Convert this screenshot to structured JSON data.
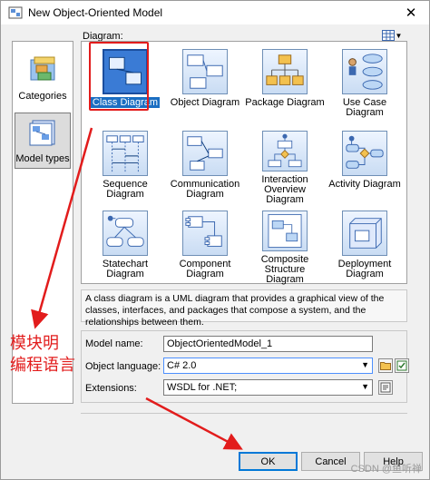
{
  "window": {
    "title": "New Object-Oriented Model",
    "close_glyph": "✕"
  },
  "rail": {
    "items": [
      {
        "label": "Categories",
        "icon": "folders-icon",
        "selected": false
      },
      {
        "label": "Model types",
        "icon": "model-types-icon",
        "selected": true
      }
    ]
  },
  "diagram_label": "Diagram:",
  "diagrams": [
    {
      "label": "Class Diagram",
      "icon": "class-diagram-icon",
      "selected": true
    },
    {
      "label": "Object Diagram",
      "icon": "object-diagram-icon"
    },
    {
      "label": "Package Diagram",
      "icon": "package-diagram-icon"
    },
    {
      "label": "Use Case Diagram",
      "icon": "use-case-diagram-icon"
    },
    {
      "label": "Sequence Diagram",
      "icon": "sequence-diagram-icon"
    },
    {
      "label": "Communication Diagram",
      "icon": "communication-diagram-icon"
    },
    {
      "label": "Interaction Overview Diagram",
      "icon": "interaction-overview-icon"
    },
    {
      "label": "Activity Diagram",
      "icon": "activity-diagram-icon"
    },
    {
      "label": "Statechart Diagram",
      "icon": "statechart-diagram-icon"
    },
    {
      "label": "Component Diagram",
      "icon": "component-diagram-icon"
    },
    {
      "label": "Composite Structure Diagram",
      "icon": "composite-structure-icon"
    },
    {
      "label": "Deployment Diagram",
      "icon": "deployment-diagram-icon"
    }
  ],
  "description": "A class diagram is a UML diagram that provides a graphical view of the classes, interfaces, and packages that compose a system, and the relationships between them.",
  "form": {
    "model_name_label": "Model name:",
    "model_name_value": "ObjectOrientedModel_1",
    "object_language_label": "Object language:",
    "object_language_value": "C# 2.0",
    "extensions_label": "Extensions:",
    "extensions_value": "WSDL for .NET;"
  },
  "buttons": {
    "ok": "OK",
    "cancel": "Cancel",
    "help": "Help"
  },
  "annotation": {
    "line1": "模块明",
    "line2": "编程语言"
  },
  "watermark": "CSDN @鱼听禅",
  "colors": {
    "annotation_red": "#e21c1c",
    "selection_blue": "#1b6ec2"
  }
}
